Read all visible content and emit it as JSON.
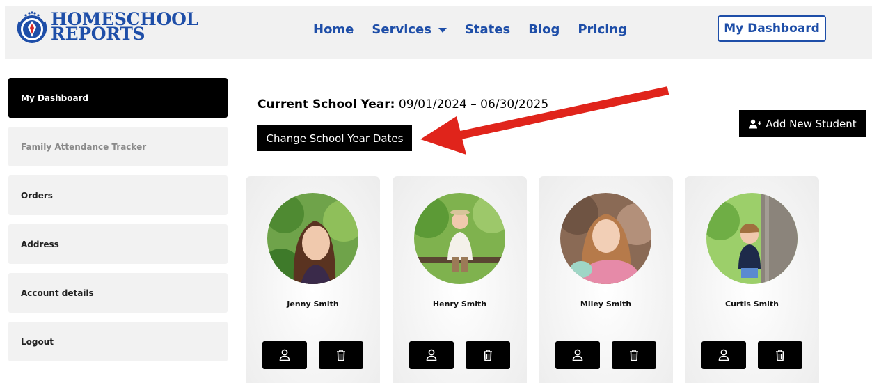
{
  "brand": {
    "line1": "HOMESCHOOL",
    "line2": "REPORTS"
  },
  "nav": {
    "home": "Home",
    "services": "Services",
    "states": "States",
    "blog": "Blog",
    "pricing": "Pricing",
    "dashboard_button": "My Dashboard"
  },
  "sidebar": {
    "items": [
      {
        "label": "My Dashboard",
        "active": true
      },
      {
        "label": "Family Attendance Tracker"
      },
      {
        "label": "Orders"
      },
      {
        "label": "Address"
      },
      {
        "label": "Account details"
      },
      {
        "label": "Logout"
      }
    ]
  },
  "school_year": {
    "label": "Current School Year:",
    "value": "09/01/2024 – 06/30/2025",
    "change_button": "Change School Year Dates"
  },
  "add_student_button": "Add New Student",
  "students": [
    {
      "name": "Jenny Smith"
    },
    {
      "name": "Henry Smith"
    },
    {
      "name": "Miley Smith"
    },
    {
      "name": "Curtis Smith"
    }
  ],
  "colors": {
    "brand_blue": "#1e4ea8",
    "arrow_red": "#e0241b",
    "button_black": "#000000"
  },
  "icons": {
    "view": "user-outline-icon",
    "delete": "trash-icon",
    "add": "user-plus-icon"
  }
}
